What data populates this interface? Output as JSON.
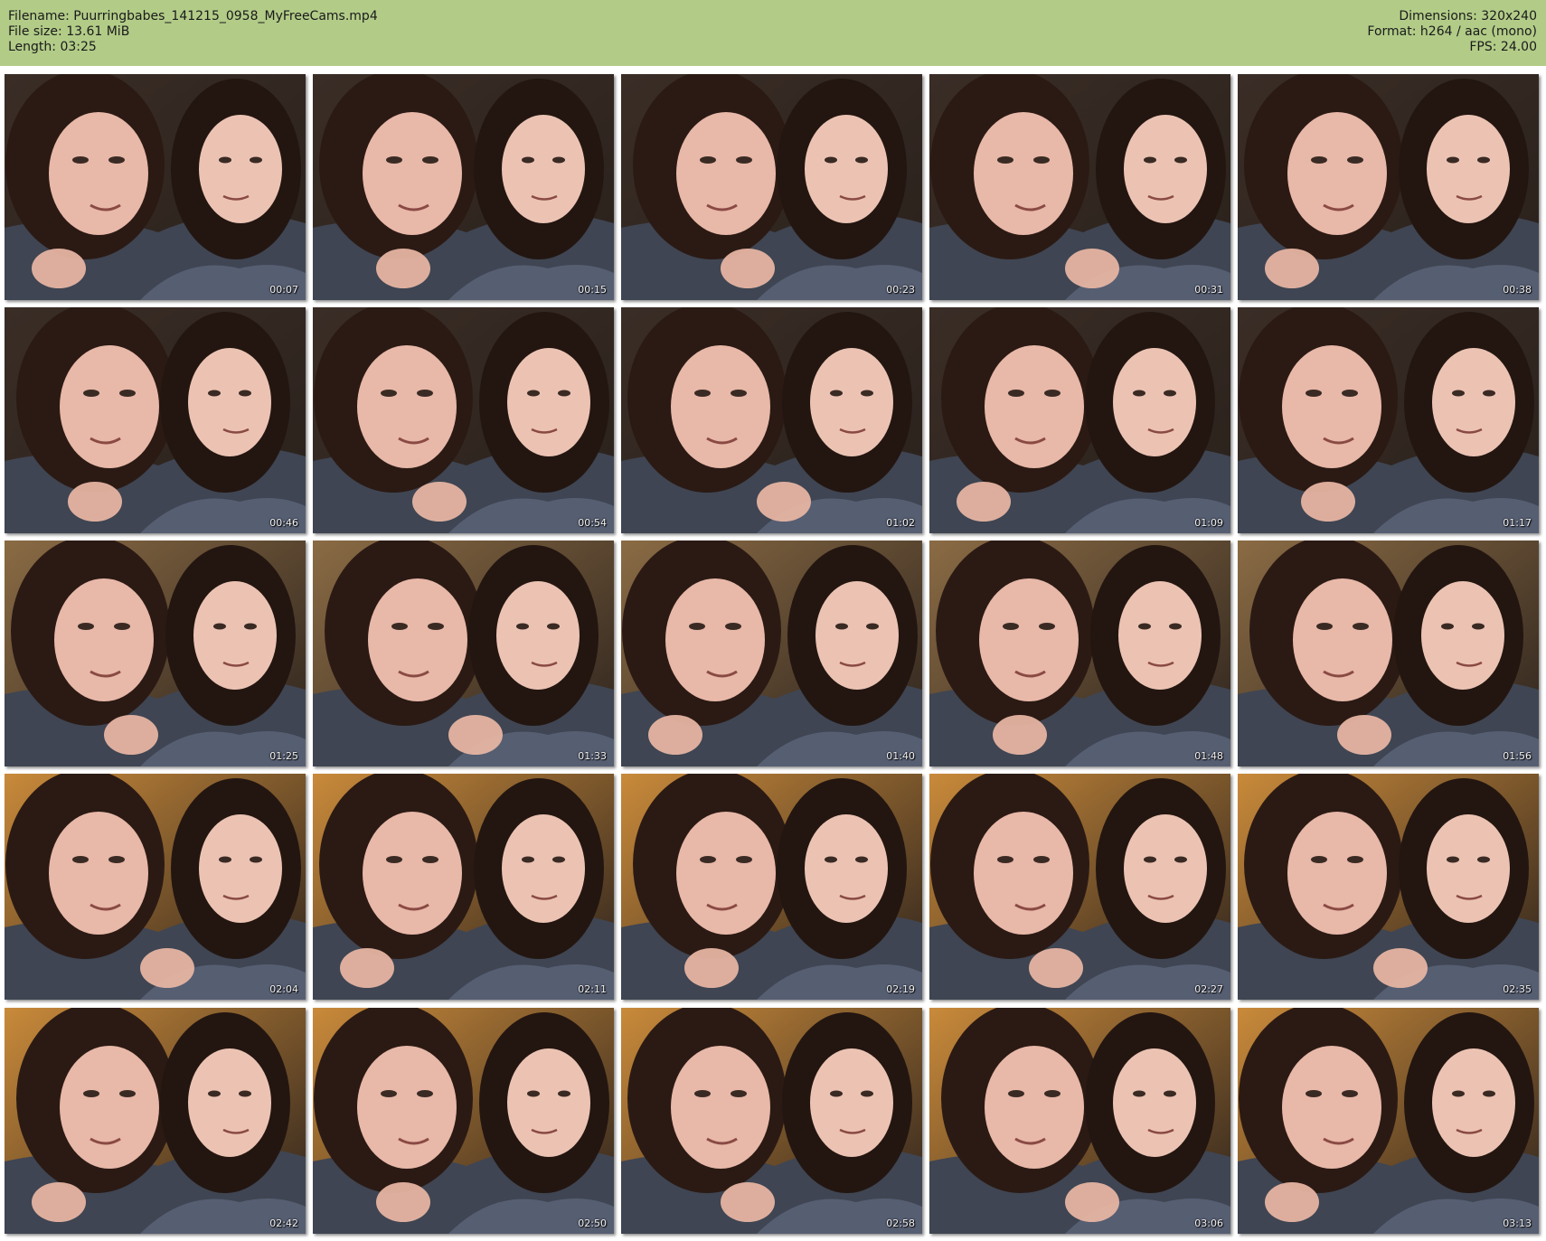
{
  "header": {
    "filename": "Filename: Puurringbabes_141215_0958_MyFreeCams.mp4",
    "filesize": "File size: 13.61 MiB",
    "length": "Length: 03:25",
    "dimensions": "Dimensions: 320x240",
    "format": "Format: h264 / aac (mono)",
    "fps": "FPS: 24.00"
  },
  "thumbnails": [
    {
      "time": "00:07"
    },
    {
      "time": "00:15"
    },
    {
      "time": "00:23"
    },
    {
      "time": "00:31"
    },
    {
      "time": "00:38"
    },
    {
      "time": "00:46"
    },
    {
      "time": "00:54"
    },
    {
      "time": "01:02"
    },
    {
      "time": "01:09"
    },
    {
      "time": "01:17"
    },
    {
      "time": "01:25"
    },
    {
      "time": "01:33"
    },
    {
      "time": "01:40"
    },
    {
      "time": "01:48"
    },
    {
      "time": "01:56"
    },
    {
      "time": "02:04"
    },
    {
      "time": "02:11"
    },
    {
      "time": "02:19"
    },
    {
      "time": "02:27"
    },
    {
      "time": "02:35"
    },
    {
      "time": "02:42"
    },
    {
      "time": "02:50"
    },
    {
      "time": "02:58"
    },
    {
      "time": "03:06"
    },
    {
      "time": "03:13"
    }
  ],
  "colors": {
    "header_bg": "#b2cc88",
    "wall_dark": "#2a211c",
    "wall_warm": "#c98a3a",
    "skin": "#e8b8a8",
    "hair": "#2b1a14",
    "hoodie": "#3f4552",
    "pattern": "#5a6378"
  }
}
